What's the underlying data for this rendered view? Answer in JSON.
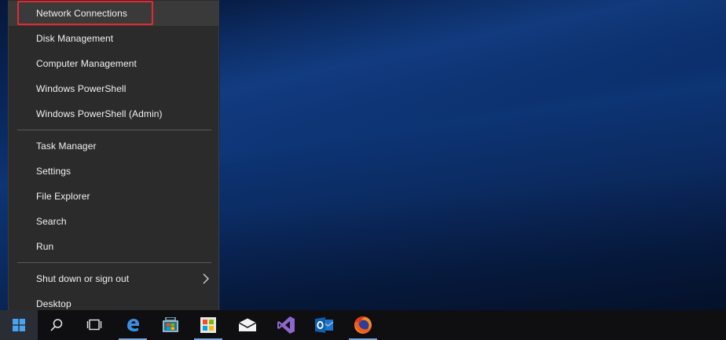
{
  "menu": {
    "items": [
      {
        "label": "Network Connections",
        "highlighted": true
      },
      {
        "label": "Disk Management"
      },
      {
        "label": "Computer Management"
      },
      {
        "label": "Windows PowerShell"
      },
      {
        "label": "Windows PowerShell (Admin)"
      },
      {
        "label": "Task Manager"
      },
      {
        "label": "Settings"
      },
      {
        "label": "File Explorer"
      },
      {
        "label": "Search"
      },
      {
        "label": "Run"
      },
      {
        "label": "Shut down or sign out",
        "has_submenu": true
      },
      {
        "label": "Desktop"
      }
    ],
    "highlight_color": "#e32a32",
    "background": "#2b2b2b",
    "text_color": "#f2f2f2"
  },
  "taskbar": {
    "icons": [
      "windows-start-icon",
      "search-icon",
      "task-view-icon",
      "edge-icon",
      "store-icon",
      "apps-icon",
      "mail-icon",
      "visual-studio-icon",
      "outlook-icon",
      "firefox-icon"
    ],
    "background": "#0f0f12"
  },
  "desktop": {
    "background": "#0a2a63"
  }
}
